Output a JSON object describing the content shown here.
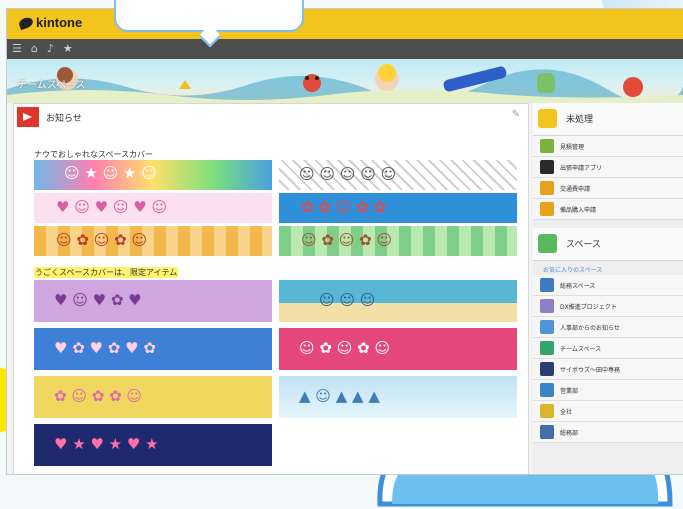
{
  "app": {
    "brand": "kintone"
  },
  "navbar": {
    "icons": [
      "menu-icon",
      "home-icon",
      "bell-icon",
      "star-icon"
    ]
  },
  "banner": {
    "title": "チームスペース"
  },
  "notice": {
    "title": "お知らせ",
    "caption1": "ナウでおしゃれなスペースカバー",
    "caption2": "うごくスペースカバーは、限定アイテム"
  },
  "sidebar": {
    "todo_title": "未処理",
    "todo_items": [
      {
        "label": "見積管理",
        "color": "#7bb23a"
      },
      {
        "label": "出張申請アプリ",
        "color": "#2a2a2a"
      },
      {
        "label": "交通費申請",
        "color": "#e6a21c"
      },
      {
        "label": "備品購入申請",
        "color": "#e6a21c"
      }
    ],
    "space_title": "スペース",
    "fav_label": "お気に入りのスペース",
    "spaces": [
      {
        "label": "総務スペース",
        "color": "#3f7bc1"
      },
      {
        "label": "DX推進プロジェクト",
        "color": "#8f7fc4"
      },
      {
        "label": "人事部からのお知らせ",
        "color": "#4f94d4"
      },
      {
        "label": "チームスペース",
        "color": "#32a56a"
      },
      {
        "label": "サイボウズ〜田中専務",
        "color": "#2b3f76"
      },
      {
        "label": "営業部",
        "color": "#3a86c5"
      },
      {
        "label": "全社",
        "color": "#d9b52c"
      },
      {
        "label": "総務部",
        "color": "#3f6ea8"
      }
    ]
  },
  "colors": {
    "kintone_yellow": "#f3c31e",
    "nav_dark": "#4d4d4d",
    "notice_red": "#e0352b",
    "space_green": "#5cb85c"
  }
}
